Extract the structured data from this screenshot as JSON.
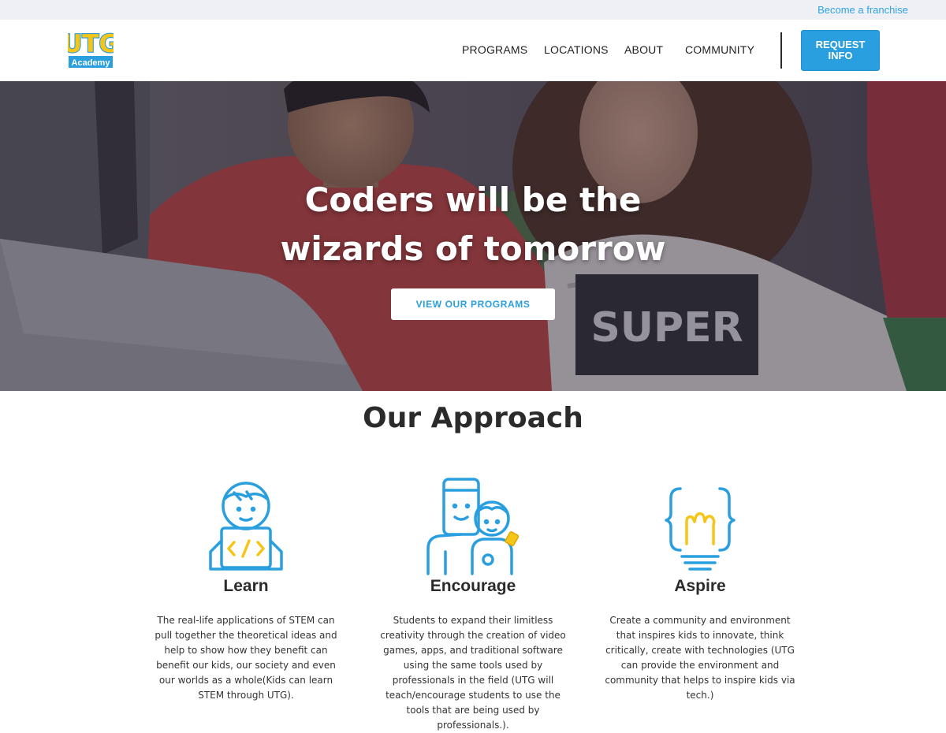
{
  "topbar": {
    "franchise_link": "Become a franchise"
  },
  "logo": {
    "text_main": "UTG",
    "text_sub": "Academy"
  },
  "nav": {
    "items": [
      {
        "label": "PROGRAMS"
      },
      {
        "label": "LOCATIONS"
      },
      {
        "label": "ABOUT"
      },
      {
        "label": "COMMUNITY"
      }
    ],
    "request_button": "REQUEST INFO"
  },
  "hero": {
    "title_line1": "Coders will be the",
    "title_line2": "wizards of tomorrow",
    "shirt_text": "SUPER",
    "cta": "VIEW OUR PROGRAMS"
  },
  "approach": {
    "title": "Our Approach",
    "columns": [
      {
        "icon": "learner-laptop-icon",
        "heading": "Learn",
        "text": "The real-life applications of STEM can pull together the theoretical ideas and help to show how they benefit can benefit our kids, our society and even our worlds as a whole(Kids can learn STEM through UTG)."
      },
      {
        "icon": "mentor-student-icon",
        "heading": "Encourage",
        "text": "Students to expand their limitless creativity through the creation of video games, apps, and traditional software using the same tools used by professionals in the field (UTG will teach/encourage students to use the tools that are being used by professionals.)."
      },
      {
        "icon": "lightbulb-braces-icon",
        "heading": "Aspire",
        "text": "Create a community and environment that inspires kids to innovate, think critically, create with technologies (UTG can provide the environment and community that helps to inspire kids via tech.)"
      }
    ]
  },
  "colors": {
    "accent": "#2a9fe0",
    "icon_yellow": "#f5c518",
    "text_dark": "#2b2b2b",
    "topbar_bg": "#eef0f5"
  }
}
